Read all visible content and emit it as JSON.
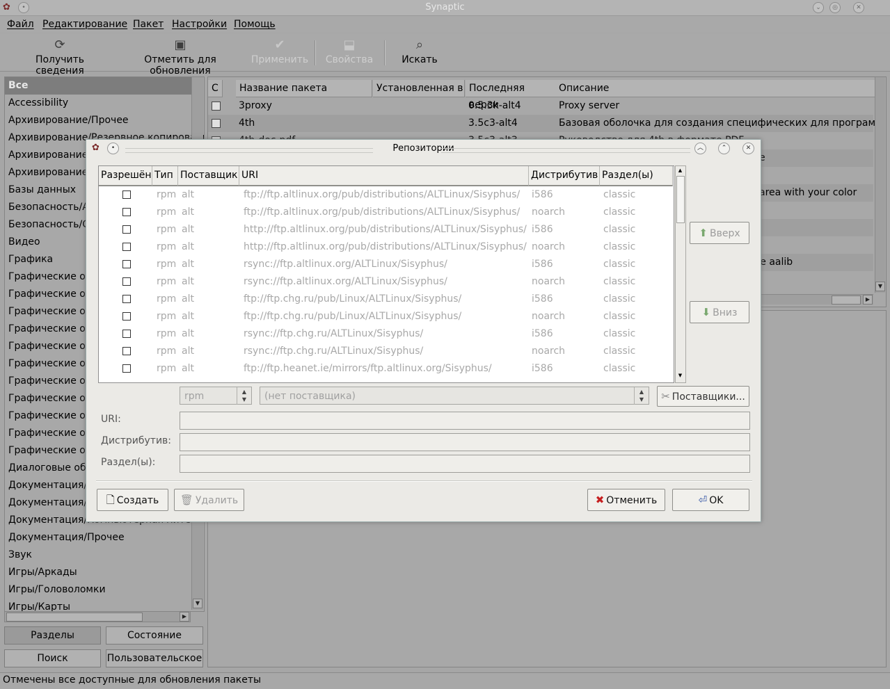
{
  "window": {
    "title": "Synaptic"
  },
  "menu": [
    "Файл",
    "Редактирование",
    "Пакет",
    "Настройки",
    "Помощь"
  ],
  "toolbar": {
    "reload": "Получить сведения",
    "mark_upgrades": "Отметить для обновления",
    "apply": "Применить",
    "properties": "Свойства",
    "search": "Искать"
  },
  "categories": [
    "Все",
    "Accessibility",
    "Архивирование/Прочее",
    "Архивирование/Резервное копирование",
    "Архивирование/Сжатие",
    "Архивирование/Эмуляторы",
    "Базы данных",
    "Безопасность/Аутентификация",
    "Безопасность/Сети",
    "Видео",
    "Графика",
    "Графические оболочки/Прочее",
    "Графические оболочки/GNOME",
    "Графические оболочки/KDE",
    "Графические оболочки/XFce",
    "Графические оболочки/Enlightenment",
    "Графические оболочки/Fluxbox",
    "Графические оболочки/Icewm",
    "Графические оболочки/Window Maker",
    "Графические оболочки/Sawfish",
    "Графические оболочки/FVWM",
    "Графические оболочки/Openbox",
    "Диалоговые оболочки",
    "Документация/Прочее",
    "Документация/HOWTO",
    "Документация/Компьютерная литература",
    "Документация/Прочее",
    "Звук",
    "Игры/Аркады",
    "Игры/Головоломки",
    "Игры/Карты"
  ],
  "left_buttons": {
    "sections": "Разделы",
    "status": "Состояние",
    "search": "Поиск",
    "custom": "Пользовательское"
  },
  "pkg_table": {
    "headers": [
      "С",
      "Название пакета",
      "Установленная в",
      "Последняя верси",
      "Описание"
    ],
    "rows": [
      {
        "name": "3proxy",
        "latest": "0.5.3k-alt4",
        "desc": "Proxy server"
      },
      {
        "name": "4th",
        "latest": "3.5c3-alt4",
        "desc": "Базовая оболочка для создания специфических для программ я"
      },
      {
        "name": "4th-doc-pdf",
        "latest": "3.5c3-alt3",
        "desc": "Руководство для 4th в формате PDF"
      }
    ],
    "partial_right": [
      {
        "text": "e"
      },
      {
        "text": "area with your color"
      },
      {
        "text": "se aalib"
      }
    ]
  },
  "status": "Отмечены все доступные для обновления пакеты",
  "dialog": {
    "title": "Репозитории",
    "headers": [
      "Разрешён",
      "Тип",
      "Поставщик",
      "URI",
      "Дистрибутив",
      "Раздел(ы)"
    ],
    "rows": [
      {
        "type": "rpm",
        "vendor": "alt",
        "uri": "ftp://ftp.altlinux.org/pub/distributions/ALTLinux/Sisyphus/",
        "dist": "i586",
        "section": "classic"
      },
      {
        "type": "rpm",
        "vendor": "alt",
        "uri": "ftp://ftp.altlinux.org/pub/distributions/ALTLinux/Sisyphus/",
        "dist": "noarch",
        "section": "classic"
      },
      {
        "type": "rpm",
        "vendor": "alt",
        "uri": "http://ftp.altlinux.org/pub/distributions/ALTLinux/Sisyphus/",
        "dist": "i586",
        "section": "classic"
      },
      {
        "type": "rpm",
        "vendor": "alt",
        "uri": "http://ftp.altlinux.org/pub/distributions/ALTLinux/Sisyphus/",
        "dist": "noarch",
        "section": "classic"
      },
      {
        "type": "rpm",
        "vendor": "alt",
        "uri": "rsync://ftp.altlinux.org/ALTLinux/Sisyphus/",
        "dist": "i586",
        "section": "classic"
      },
      {
        "type": "rpm",
        "vendor": "alt",
        "uri": "rsync://ftp.altlinux.org/ALTLinux/Sisyphus/",
        "dist": "noarch",
        "section": "classic"
      },
      {
        "type": "rpm",
        "vendor": "alt",
        "uri": "ftp://ftp.chg.ru/pub/Linux/ALTLinux/Sisyphus/",
        "dist": "i586",
        "section": "classic"
      },
      {
        "type": "rpm",
        "vendor": "alt",
        "uri": "ftp://ftp.chg.ru/pub/Linux/ALTLinux/Sisyphus/",
        "dist": "noarch",
        "section": "classic"
      },
      {
        "type": "rpm",
        "vendor": "alt",
        "uri": "rsync://ftp.chg.ru/ALTLinux/Sisyphus/",
        "dist": "i586",
        "section": "classic"
      },
      {
        "type": "rpm",
        "vendor": "alt",
        "uri": "rsync://ftp.chg.ru/ALTLinux/Sisyphus/",
        "dist": "noarch",
        "section": "classic"
      },
      {
        "type": "rpm",
        "vendor": "alt",
        "uri": "ftp://ftp.heanet.ie/mirrors/ftp.altlinux.org/Sisyphus/",
        "dist": "i586",
        "section": "classic"
      }
    ],
    "up": "Вверх",
    "down": "Вниз",
    "type_value": "rpm",
    "vendor_value": "(нет поставщика)",
    "vendors_button": "Поставщики...",
    "labels": {
      "uri": "URI:",
      "dist": "Дистрибутив:",
      "section": "Раздел(ы):"
    },
    "create": "Создать",
    "delete": "Удалить",
    "cancel": "Отменить",
    "ok": "OK"
  }
}
